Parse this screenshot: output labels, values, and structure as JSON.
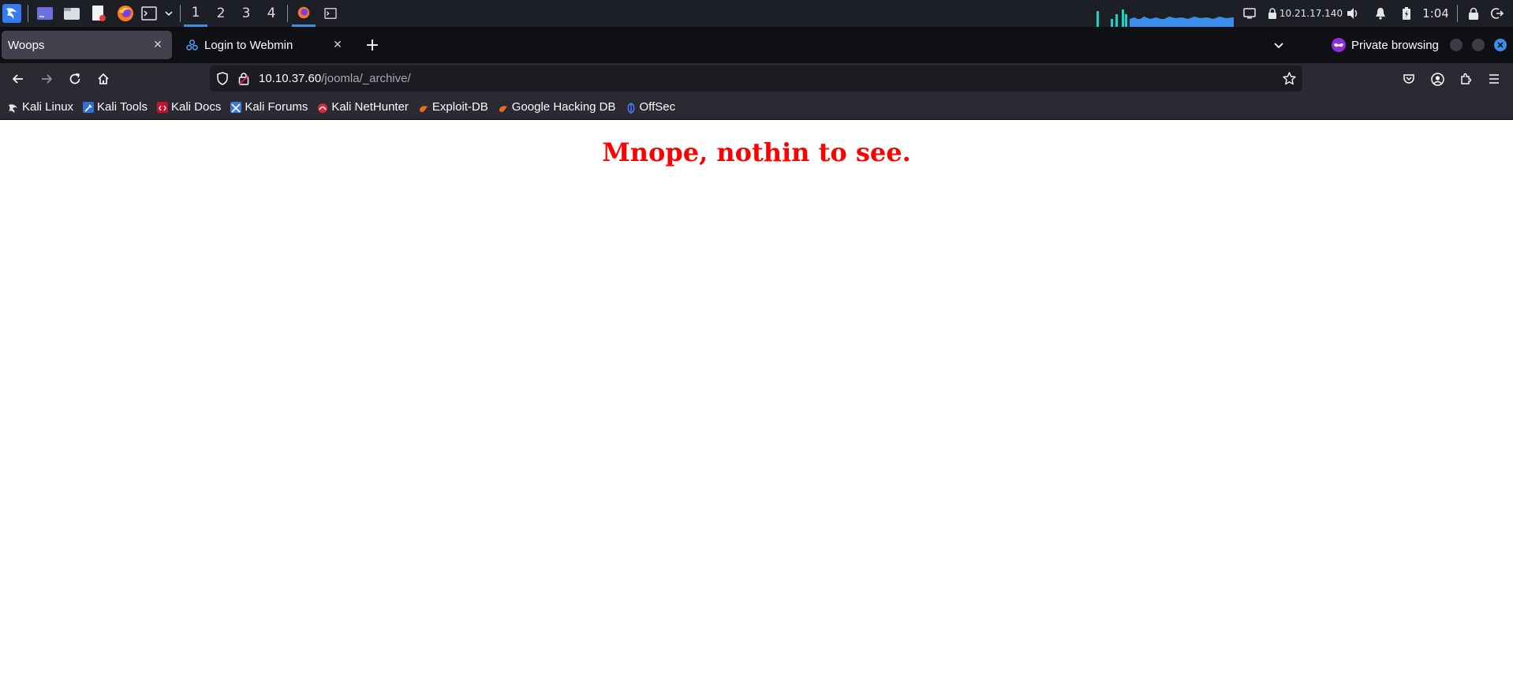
{
  "panel": {
    "workspaces": [
      "1",
      "2",
      "3",
      "4"
    ],
    "active_workspace": "1",
    "ip_address": "10.21.17.140",
    "clock": "1:04"
  },
  "tabs": [
    {
      "title": "Woops",
      "active": true
    },
    {
      "title": "Login to Webmin",
      "active": false
    }
  ],
  "private_browsing_label": "Private browsing",
  "address_bar": {
    "host": "10.10.37.60",
    "path": "/joomla/_archive/"
  },
  "bookmarks": [
    {
      "label": "Kali Linux",
      "icon": "kali-dragon-icon"
    },
    {
      "label": "Kali Tools",
      "icon": "kali-tools-icon"
    },
    {
      "label": "Kali Docs",
      "icon": "kali-docs-icon"
    },
    {
      "label": "Kali Forums",
      "icon": "kali-forums-icon"
    },
    {
      "label": "Kali NetHunter",
      "icon": "nethunter-icon"
    },
    {
      "label": "Exploit-DB",
      "icon": "exploit-db-icon"
    },
    {
      "label": "Google Hacking DB",
      "icon": "ghdb-icon"
    },
    {
      "label": "OffSec",
      "icon": "offsec-icon"
    }
  ],
  "page": {
    "heading": "Mnope, nothin to see.",
    "heading_color": "#ff0000"
  },
  "colors": {
    "panel_bg": "#1c1f26",
    "tabstrip_bg": "#0f1014",
    "toolbar_bg": "#2b2a33",
    "accent": "#3b8eea"
  }
}
